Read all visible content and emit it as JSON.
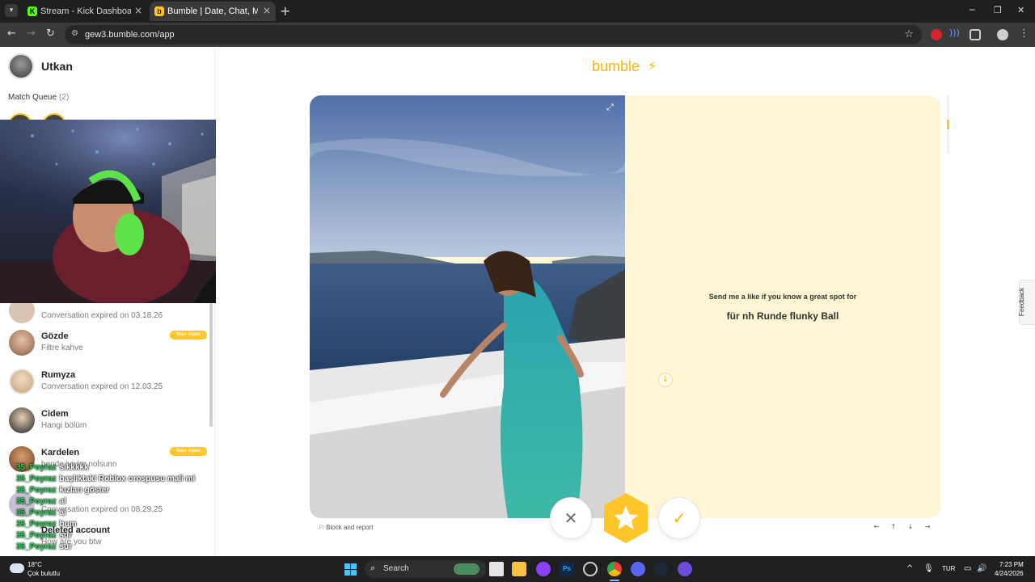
{
  "browser": {
    "tabs": [
      {
        "title": "Stream - Kick Dashboard",
        "active": false
      },
      {
        "title": "Bumble | Date, Chat, Meet New",
        "active": true
      }
    ],
    "url": "gew3.bumble.com/app"
  },
  "sidebar": {
    "user_name": "Utkan",
    "match_queue_label": "Match Queue",
    "match_queue_count": "(2)",
    "conversations": [
      {
        "name": "",
        "message": "Conversation expired on 03.18.26",
        "badge": ""
      },
      {
        "name": "Gözde",
        "message": "Filtre kahve",
        "badge": "Your move"
      },
      {
        "name": "Rumyza",
        "message": "Conversation expired on 12.03.25",
        "badge": ""
      },
      {
        "name": "Cidem",
        "message": "Hangi bölüm",
        "badge": ""
      },
      {
        "name": "Kardelen",
        "message": "bende iyiyim nolsunn",
        "badge": "Your move"
      },
      {
        "name": "",
        "message": "Conversation expired on 08.29.25",
        "badge": ""
      },
      {
        "name": "Deleted account",
        "message": "How are you btw",
        "badge": ""
      }
    ]
  },
  "stream_chat": [
    {
      "user": "35_Poyraz",
      "text": "sikkkkk"
    },
    {
      "user": "35_Poyraz",
      "text": "başlıktaki Roblox orospusu mali mi"
    },
    {
      "user": "35_Poyraz",
      "text": "kızları göster"
    },
    {
      "user": "35_Poyraz",
      "text": "al"
    },
    {
      "user": "35_Poyraz",
      "text": "ai"
    },
    {
      "user": "35_Poyraz",
      "text": "bum"
    },
    {
      "user": "35_Poyraz",
      "text": "sur"
    },
    {
      "user": "35_Poyraz",
      "text": "sur"
    }
  ],
  "main": {
    "brand": "bumble",
    "profile": {
      "prompt_label": "Send me a like if you know a great spot for",
      "prompt_answer": "für nh Runde flunky Ball"
    },
    "block_report_label": "Block and report",
    "feedback_label": "Feedback",
    "keyboard_hints": [
      "←",
      "↑",
      "↓",
      "→"
    ]
  },
  "taskbar": {
    "weather_temp": "18°C",
    "weather_desc": "Çok bulutlu",
    "search_label": "Search",
    "language": "TUR",
    "time": "7:23 PM",
    "date": "4/24/2026"
  },
  "colors": {
    "bumble_yellow": "#ffc629",
    "kick_green": "#53fc18",
    "chat_user_green": "#2ecf5a",
    "prompt_bg": "#fff6d6"
  }
}
